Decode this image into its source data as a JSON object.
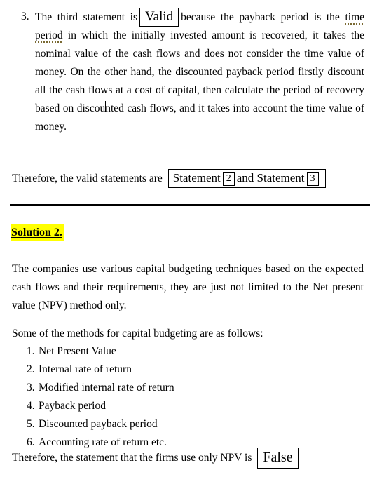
{
  "document": {
    "statement3": {
      "marker": "3.",
      "text_before_answer": "The third statement is",
      "answer": "Valid",
      "text_after_answer_1": "because the payback period is the",
      "highlighted_term": "time period",
      "text_after_term_a": "in which the initially invested amount is recovered, it takes the nominal value of the cash flows and does not consider the time value of money. On the other hand, the discounted payback period firstly discount all the cash flows at a cost of capital, then calculate the period of recovery based on discou",
      "text_after_term_b": "nted cash flows, and it takes into account the time value of money."
    },
    "conclusion1": {
      "lead_in": "Therefore, the valid statements are",
      "boxed": {
        "label_first": "Statement",
        "number_first": "2",
        "conjunction": "and Statement",
        "number_second": "3"
      }
    },
    "solution2": {
      "heading": "Solution 2.",
      "intro_paragraph": "The companies use various capital budgeting techniques based on the expected cash flows and their requirements, they are just not limited to the Net present value (NPV) method only.",
      "methods_lead_in": "Some of the methods for capital budgeting are as follows:",
      "methods": [
        {
          "number": "1.",
          "label": "Net Present Value"
        },
        {
          "number": "2.",
          "label": "Internal rate of return"
        },
        {
          "number": "3.",
          "label": "Modified internal rate of return"
        },
        {
          "number": "4.",
          "label": "Payback period"
        },
        {
          "number": "5.",
          "label": "Discounted payback period"
        },
        {
          "number": "6.",
          "label": "Accounting rate of return etc."
        }
      ],
      "conclusion": {
        "lead_in": "Therefore, the statement that the firms use only NPV is",
        "answer": "False"
      }
    },
    "colors": {
      "highlight": "#ffff00",
      "text": "#000000",
      "background": "#ffffff",
      "term_underline": "#7a6a33",
      "box_border": "#000000"
    }
  }
}
